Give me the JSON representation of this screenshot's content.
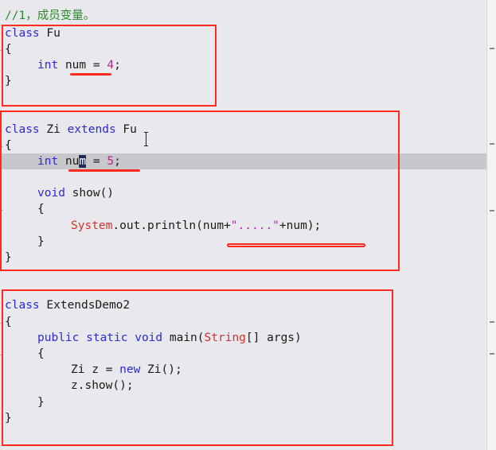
{
  "editor": {
    "lines": {
      "l1": "//1，成员变量。",
      "l2_kw": "class",
      "l2_name": " Fu",
      "l3": "{",
      "l4_kw": "int",
      "l4_var": "num",
      "l4_eq": " = ",
      "l4_num": "4",
      "l4_end": ";",
      "l5": "}",
      "l7_kw": "class",
      "l7_name": " Zi ",
      "l7_ext": "extends",
      "l7_sup": " Fu",
      "l8": "{",
      "l9_kw": "int",
      "l9_var_a": "nu",
      "l9_var_sel": "m",
      "l9_eq": " = ",
      "l9_num": "5",
      "l9_end": ";",
      "l11_kw": "void",
      "l11_rest": " show()",
      "l12": "{",
      "l13_cls": "System",
      "l13_a": ".out.println(num+",
      "l13_str": "\".....\"",
      "l13_b": "+num);",
      "l14": "}",
      "l15": "}",
      "l18_kw": "class",
      "l18_name": " ExtendsDemo2",
      "l19": "{",
      "l20_kw": "public static void",
      "l20_a": " main(",
      "l20_cls": "String",
      "l20_b": "[] args)",
      "l21": "{",
      "l22_a": "Zi z = ",
      "l22_kw": "new",
      "l22_b": " Zi();",
      "l23": "z.show();",
      "l24": "}",
      "l25": "}"
    }
  },
  "colors": {
    "keyword": "#2b2bd6",
    "number": "#b0278e",
    "comment": "#2a8a2a",
    "string": "#c01fc0",
    "annotation": "#ff2a20"
  }
}
